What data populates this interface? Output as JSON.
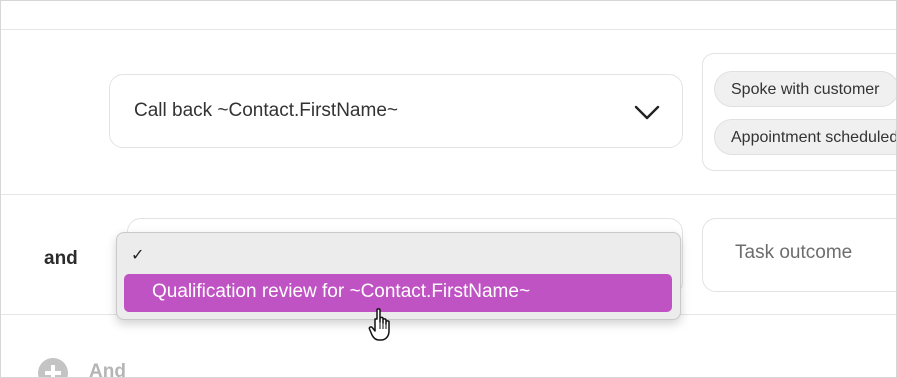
{
  "row1": {
    "task_title": "Call back ~Contact.FirstName~",
    "tags": [
      "Spoke with customer",
      "Appointment scheduled"
    ]
  },
  "row2": {
    "connector": "and",
    "outcome_placeholder": "Task outcome"
  },
  "dropdown": {
    "checkmark": "✓",
    "highlighted_option": "Qualification review for ~Contact.FirstName~"
  },
  "add_condition": {
    "label": "And"
  },
  "colors": {
    "accent_highlight": "#c053c4",
    "border": "#e3e3e3",
    "tag_bg": "#f0f0f0"
  }
}
